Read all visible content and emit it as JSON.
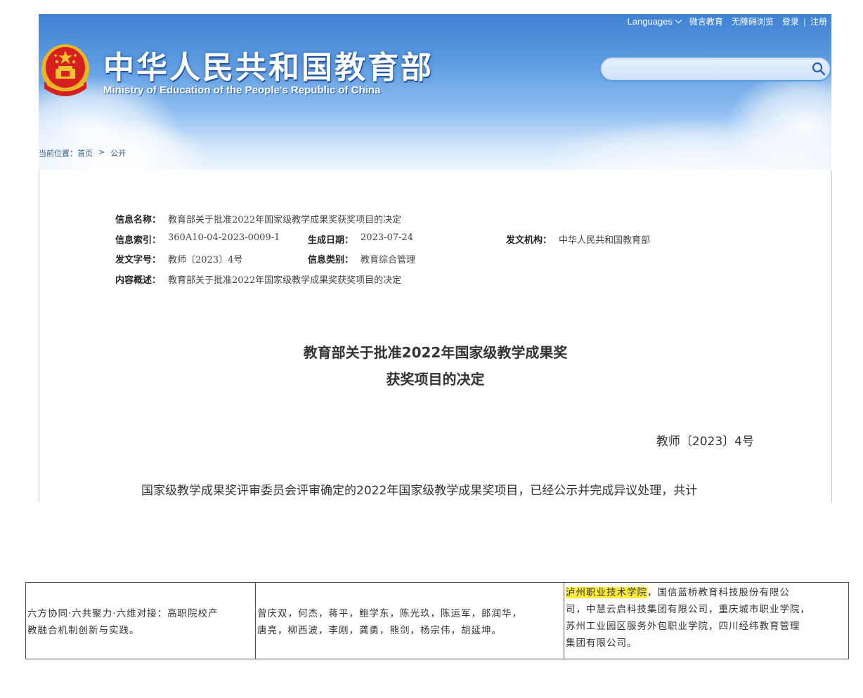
{
  "header": {
    "site_title": "中华人民共和国教育部",
    "site_subtitle": "Ministry of Education of the People's Republic of China",
    "nav": {
      "languages": "Languages",
      "weiyan": "微言教育",
      "accessible": "无障碍浏览",
      "login": "登录",
      "separator": "|",
      "register": "注册"
    },
    "search": {
      "placeholder": ""
    },
    "breadcrumb": {
      "label": "当前位置：",
      "home": "首页",
      "arrow": ">",
      "current": "公开"
    },
    "colors": {
      "banner_top": "#3f82d3",
      "banner_bottom": "#eef6fe",
      "emblem_red": "#d6201d",
      "emblem_gold": "#f2c230"
    }
  },
  "meta": {
    "name_label": "信息名称：",
    "name_value": "教育部关于批准2022年国家级教学成果奖获奖项目的决定",
    "index_label": "信息索引：",
    "index_value": "360A10-04-2023-0009-1",
    "date_label": "生成日期：",
    "date_value": "2023-07-24",
    "org_label": "发文机构：",
    "org_value": "中华人民共和国教育部",
    "docno_label": "发文字号：",
    "docno_value": "教师〔2023〕4号",
    "category_label": "信息类别：",
    "category_value": "教育综合管理",
    "summary_label": "内容概述：",
    "summary_value": "教育部关于批准2022年国家级教学成果奖获奖项目的决定"
  },
  "document": {
    "title_line1": "教育部关于批准2022年国家级教学成果奖",
    "title_line2": "获奖项目的决定",
    "doc_number": "教师〔2023〕4号",
    "first_paragraph": "国家级教学成果奖评审委员会评审确定的2022年国家级教学成果奖项目，已经公示并完成异议处理，共计"
  },
  "table": {
    "project": [
      "六方协同·六共聚力·六维对接：高职院校产",
      "教融合机制创新与实践。"
    ],
    "members": [
      "曾庆双，何杰，蒋平，鲍学东，陈光玖，陈运军，郎润华，",
      "唐亮，柳西波，李刚，龚勇，熊剑，杨宗伟，胡延坤。"
    ],
    "units_highlight": "泸州职业技术学院",
    "units_line1_rest": "，国信蓝桥教育科技股份有限公",
    "units_lines": [
      "司，中慧云启科技集团有限公司，重庆城市职业学院，",
      "苏州工业园区服务外包职业学院，四川经纬教育管理",
      "集团有限公司。"
    ],
    "highlight_color": "#ffec3d"
  }
}
